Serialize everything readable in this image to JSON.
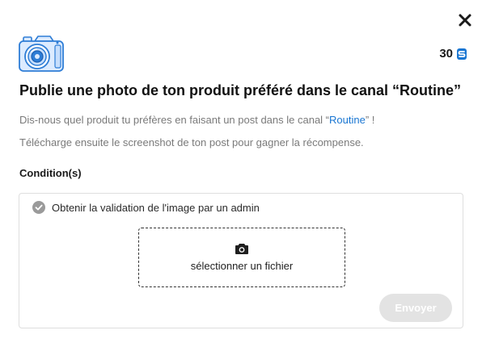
{
  "modal": {
    "points": "30",
    "title": "Publie une photo de ton produit préféré dans le canal “Routine”",
    "description_1_before": "Dis-nous quel produit tu préfères en faisant un post dans le canal “",
    "description_1_link": "Routine",
    "description_1_after": "” !",
    "description_2": "Télécharge ensuite le screenshot de ton post pour gagner la récompense.",
    "conditions_label": "Condition(s)",
    "condition_text": "Obtenir la validation de l'image par un admin",
    "upload_label": "sélectionner un fichier",
    "submit_label": "Envoyer"
  },
  "icons": {
    "close": "close-icon",
    "points": "points-currency-icon",
    "illustration": "camera-illustration",
    "condition": "check-circle-icon",
    "upload": "camera-icon"
  },
  "colors": {
    "accent": "#1976d2",
    "illustration_stroke": "#2e7dd6",
    "illustration_fill": "#dcebff",
    "check": "#9a9a9a",
    "disabled_button": "#e3e3e3",
    "description_text": "#7a7a7a"
  }
}
